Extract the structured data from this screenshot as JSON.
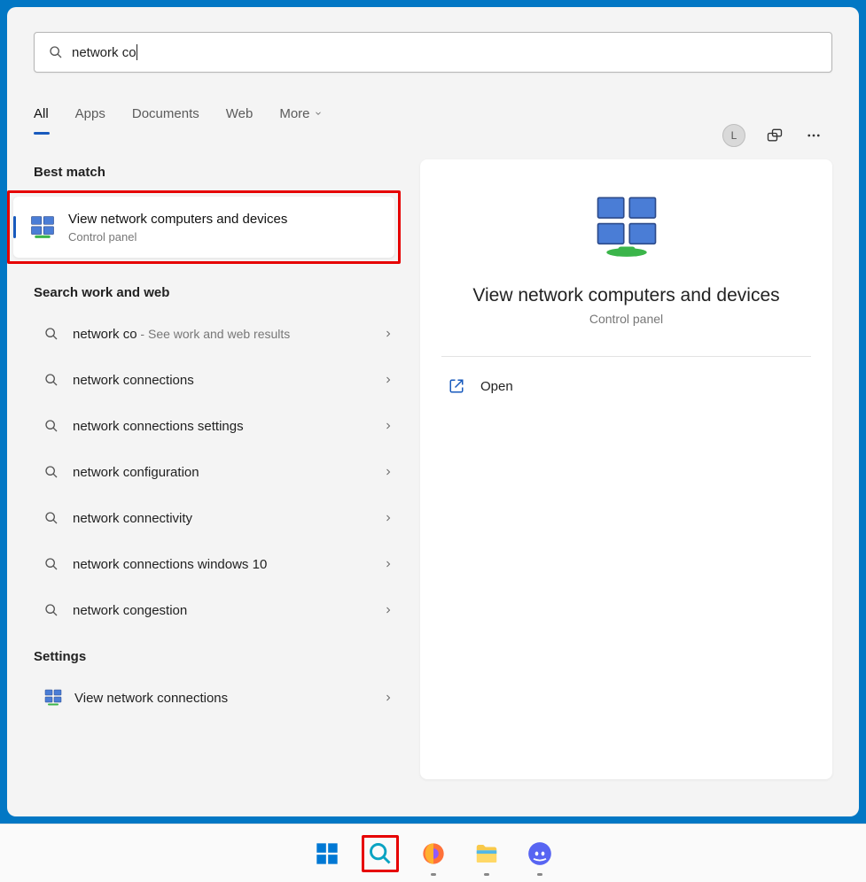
{
  "search": {
    "query": "network co"
  },
  "tabs": {
    "all": "All",
    "apps": "Apps",
    "documents": "Documents",
    "web": "Web",
    "more": "More"
  },
  "avatar_initial": "L",
  "sections": {
    "best_match": "Best match",
    "search_work_web": "Search work and web",
    "settings": "Settings"
  },
  "best_match": {
    "title": "View network computers and devices",
    "subtitle": "Control panel"
  },
  "suggestions": [
    {
      "prefix": "network co",
      "suffix": " - See work and web results"
    },
    {
      "text": "network connections"
    },
    {
      "text": "network connections settings"
    },
    {
      "text": "network configuration"
    },
    {
      "text": "network connectivity"
    },
    {
      "text": "network connections windows 10"
    },
    {
      "text": "network congestion"
    }
  ],
  "settings_item": {
    "text": "View network connections"
  },
  "detail": {
    "title": "View network computers and devices",
    "subtitle": "Control panel",
    "open": "Open"
  }
}
